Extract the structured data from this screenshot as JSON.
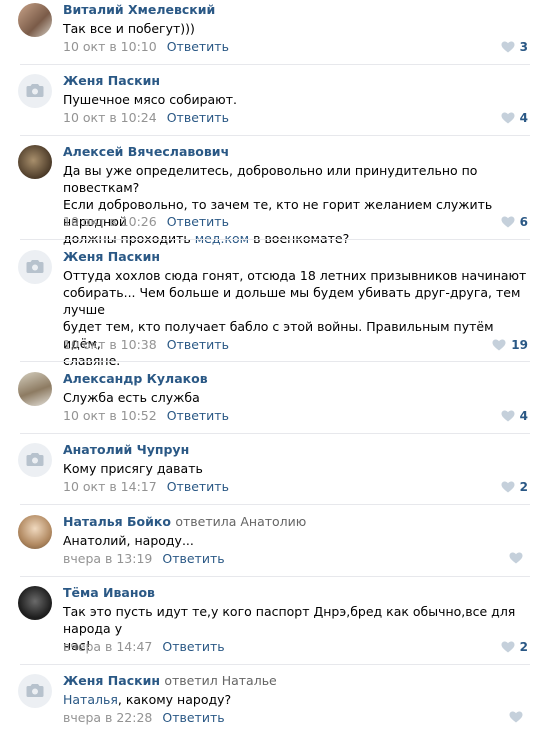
{
  "comments": [
    {
      "author": "Виталий Хмелевский",
      "reply_to": "",
      "text": "Так все и побегут)))",
      "text_link": "",
      "text_after": "",
      "date": "10 окт в 10:10",
      "reply_label": "Ответить",
      "likes": "3"
    },
    {
      "author": "Женя Паскин",
      "reply_to": "",
      "text": "Пушечное мясо собирают.",
      "text_link": "",
      "text_after": "",
      "date": "10 окт в 10:24",
      "reply_label": "Ответить",
      "likes": "4"
    },
    {
      "author": "Алексей Вячеславович",
      "reply_to": "",
      "text": "Да вы уже определитесь, добровольно или принудительно по повесткам?\nЕсли добровольно, то зачем те, кто не горит желанием служить народной\nдолжны проходить ",
      "text_link": "мед.ком",
      "text_after": " в военкомате?",
      "date": "10 окт в 10:26",
      "reply_label": "Ответить",
      "likes": "6"
    },
    {
      "author": "Женя Паскин",
      "reply_to": "",
      "text": "Оттуда хохлов сюда гонят, отсюда 18 летних призывников начинают\nсобирать... Чем больше и дольше мы будем убивать друг-друга, тем лучше\nбудет тем, кто получает бабло с этой войны. Правильным путём идём,\nславяне.",
      "text_link": "",
      "text_after": "",
      "date": "10 окт в 10:38",
      "reply_label": "Ответить",
      "likes": "19"
    },
    {
      "author": "Александр Кулаков",
      "reply_to": "",
      "text": "Служба есть служба",
      "text_link": "",
      "text_after": "",
      "date": "10 окт в 10:52",
      "reply_label": "Ответить",
      "likes": "4"
    },
    {
      "author": "Анатолий Чупрун",
      "reply_to": "",
      "text": "Кому присягу давать",
      "text_link": "",
      "text_after": "",
      "date": "10 окт в 14:17",
      "reply_label": "Ответить",
      "likes": "2"
    },
    {
      "author": "Наталья Бойко",
      "reply_to": "ответила Анатолию",
      "text": "Анатолий, народу...",
      "text_link": "",
      "text_after": "",
      "date": "вчера в 13:19",
      "reply_label": "Ответить",
      "likes": ""
    },
    {
      "author": "Тёма Иванов",
      "reply_to": "",
      "text": "Так это пусть идут те,у кого паспорт Днрэ,бред как обычно,все для народа у\nнас!",
      "text_link": "",
      "text_after": "",
      "date": "вчера в 14:47",
      "reply_label": "Ответить",
      "likes": "2"
    },
    {
      "author": "Женя Паскин",
      "reply_to": "ответил Наталье",
      "text": "",
      "text_link": "Наталья",
      "text_after": ", какому народу?",
      "date": "вчера в 22:28",
      "reply_label": "Ответить",
      "likes": ""
    }
  ],
  "colors": {
    "link": "#2a5885",
    "meta": "#939393",
    "divider": "#e7e8ec",
    "like_empty": "#c5d0db"
  }
}
